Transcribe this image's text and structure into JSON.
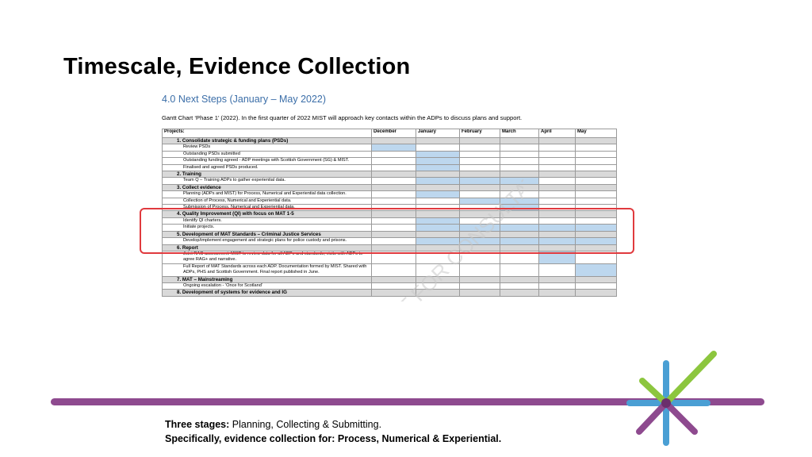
{
  "slide": {
    "title": "Timescale, Evidence Collection"
  },
  "document": {
    "heading": "4.0 Next Steps (January – May 2022)",
    "intro": "Gantt Chart ‘Phase 1’ (2022). In the first quarter of 2022 MIST will approach key contacts within the ADPs to discuss plans and support.",
    "watermark": "DRAFT FOR CONSULTATION",
    "columns": [
      "Projects:",
      "December",
      "January",
      "February",
      "March",
      "April",
      "May"
    ],
    "rows": [
      {
        "type": "section",
        "label": "1.   Consolidate strategic & funding plans (PSDs)",
        "fill": [
          0,
          0,
          0,
          0,
          0,
          0
        ]
      },
      {
        "type": "task",
        "label": "Review PSDs",
        "fill": [
          1,
          0,
          0,
          0,
          0,
          0
        ]
      },
      {
        "type": "task",
        "label": "Outstanding PSDs submitted",
        "fill": [
          0,
          1,
          0,
          0,
          0,
          0
        ]
      },
      {
        "type": "task",
        "label": "Outstanding funding agreed - ADP meetings with Scottish Government (SG) & MIST.",
        "fill": [
          0,
          1,
          0,
          0,
          0,
          0
        ]
      },
      {
        "type": "task",
        "label": "Finalised and agreed PSDs produced.",
        "fill": [
          0,
          1,
          0,
          0,
          0,
          0
        ]
      },
      {
        "type": "section",
        "label": "2.   Training",
        "fill": [
          0,
          0,
          0,
          0,
          0,
          0
        ]
      },
      {
        "type": "task",
        "label": "Team Q – Training ADPs to gather experiential data.",
        "fill": [
          0,
          1,
          1,
          1,
          0,
          0
        ]
      },
      {
        "type": "section",
        "label": "3.   Collect evidence",
        "fill": [
          0,
          0,
          0,
          0,
          0,
          0
        ]
      },
      {
        "type": "task",
        "label": "Planning (ADPs and MIST) for Process, Numerical and Experiential data collection.",
        "fill": [
          0,
          1,
          0,
          0,
          0,
          0
        ]
      },
      {
        "type": "task",
        "label": "Collection of Process, Numerical and Experiential data.",
        "fill": [
          0,
          0,
          1,
          1,
          0,
          0
        ]
      },
      {
        "type": "task",
        "label": "Submission of Process, Numerical and Experiential data.",
        "fill": [
          0,
          0,
          0,
          1,
          0,
          0
        ]
      },
      {
        "type": "section",
        "label": "4.   Quality Improvement (QI) with focus on MAT 1-5",
        "fill": [
          0,
          0,
          0,
          0,
          0,
          0
        ]
      },
      {
        "type": "task",
        "label": "Identify QI charters.",
        "fill": [
          0,
          1,
          0,
          0,
          0,
          0
        ]
      },
      {
        "type": "task",
        "label": "Initiate projects.",
        "fill": [
          0,
          1,
          1,
          1,
          1,
          1
        ]
      },
      {
        "type": "section",
        "label": "5.   Development of MAT Standards – Criminal Justice Services",
        "fill": [
          0,
          0,
          0,
          0,
          0,
          0
        ]
      },
      {
        "type": "task",
        "label": "Develop/implement engagement and strategic plans for police custody and prisons.",
        "fill": [
          0,
          1,
          1,
          1,
          1,
          1
        ]
      },
      {
        "type": "section",
        "label": "6.   Report",
        "fill": [
          0,
          0,
          0,
          0,
          0,
          0
        ]
      },
      {
        "type": "task",
        "label": "Joint RAG assessment. MIST to review data for all ADPs and standards, visits with ADPs to agree RAG+ and narrative.",
        "fill": [
          0,
          0,
          0,
          0,
          1,
          0
        ]
      },
      {
        "type": "task",
        "label": "Full Report of MAT Standards across each ADP. Documentation formed by MIST. Shared with ADPs, PHS and Scottish Government. Final report published in June.",
        "fill": [
          0,
          0,
          0,
          0,
          0,
          1
        ]
      },
      {
        "type": "section",
        "label": "7.   MAT – Mainstreaming",
        "fill": [
          0,
          0,
          0,
          0,
          0,
          0
        ]
      },
      {
        "type": "task",
        "label": "Ongoing escalation - ‘Once for Scotland’",
        "fill": [
          0,
          0,
          0,
          0,
          0,
          0
        ]
      },
      {
        "type": "section",
        "label": "8.   Development of systems for evidence and IG",
        "fill": [
          0,
          0,
          0,
          0,
          0,
          0
        ]
      }
    ]
  },
  "caption": {
    "line1_bold": "Three stages:",
    "line1_rest": " Planning, Collecting & Submitting.",
    "line2": "Specifically, evidence collection for: Process, Numerical & Experiential."
  },
  "colors": {
    "accent_purple": "#8e4a8f",
    "highlight_red": "#e03a3e",
    "gantt_fill": "#bdd7ee",
    "heading_blue": "#3b6ea8"
  }
}
